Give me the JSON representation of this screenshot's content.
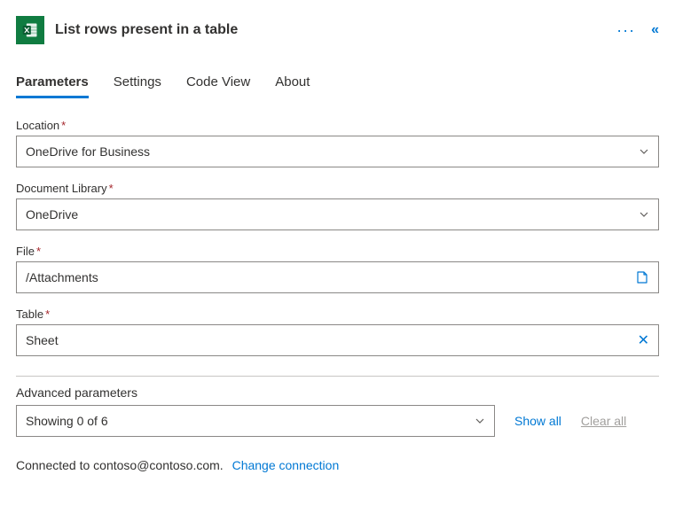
{
  "header": {
    "title": "List rows present in a table"
  },
  "tabs": {
    "parameters": "Parameters",
    "settings": "Settings",
    "codeview": "Code View",
    "about": "About"
  },
  "fields": {
    "location": {
      "label": "Location",
      "value": "OneDrive for Business"
    },
    "library": {
      "label": "Document Library",
      "value": "OneDrive"
    },
    "file": {
      "label": "File",
      "value": "/Attachments"
    },
    "table": {
      "label": "Table",
      "value": "Sheet"
    }
  },
  "advanced": {
    "label": "Advanced parameters",
    "summary": "Showing 0 of 6",
    "show_all": "Show all",
    "clear_all": "Clear all"
  },
  "footer": {
    "connected": "Connected to contoso@contoso.com.",
    "change": "Change connection"
  },
  "required_marker": "*"
}
